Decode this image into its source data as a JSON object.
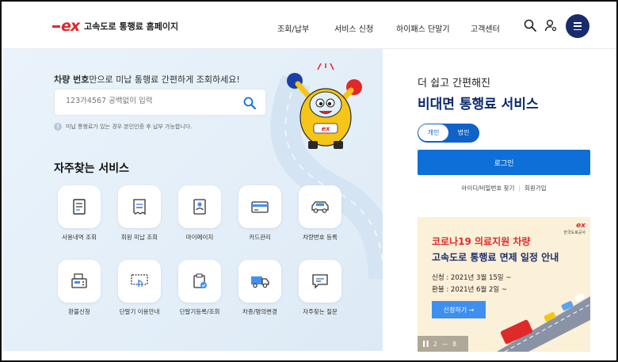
{
  "header": {
    "logo_mark": "ex",
    "site_name": "고속도로 통행료 홈페이지",
    "nav": [
      {
        "label": "조회/납부"
      },
      {
        "label": "서비스 신청"
      },
      {
        "label": "하이패스 단말기"
      },
      {
        "label": "고객센터"
      }
    ]
  },
  "search_section": {
    "headline_bold": "차량 번호",
    "headline_rest": "만으로 미납 통행료 간편하게 조회하세요!",
    "placeholder": "123가4567 공백없이 입력",
    "notice": "미납 통행료가 있는 경우 본인인증 후 납부 가능합니다."
  },
  "frequent": {
    "title": "자주찾는 서비스",
    "items": [
      {
        "label": "사용내역 조회",
        "icon": "document-list-icon"
      },
      {
        "label": "회원 미납 조회",
        "icon": "receipt-icon"
      },
      {
        "label": "마이페이지",
        "icon": "profile-card-icon"
      },
      {
        "label": "카드관리",
        "icon": "credit-card-icon"
      },
      {
        "label": "차량번호 등록",
        "icon": "car-icon"
      },
      {
        "label": "환불신청",
        "icon": "fax-icon"
      },
      {
        "label": "단말기 이용안내",
        "icon": "touch-terminal-icon"
      },
      {
        "label": "단말기등록/조회",
        "icon": "clipboard-check-icon"
      },
      {
        "label": "차종/명의변경",
        "icon": "truck-icon"
      },
      {
        "label": "자주찾는 질문",
        "icon": "chat-bubble-icon"
      }
    ]
  },
  "login_panel": {
    "subtitle": "더 쉽고 간편해진",
    "title": "비대면 통행료 서비스",
    "toggle": {
      "personal": "개인",
      "corporate": "법인"
    },
    "login_label": "로그인",
    "find_id_pw": "아이디/비밀번호 찾기",
    "separator": "|",
    "signup": "회원가입"
  },
  "banner": {
    "logo_mark": "ex",
    "logo_caption": "한국도로공사",
    "line1": "코로나19 의료지원 차량",
    "line2": "고속도로 통행료 면제 일정 안내",
    "date1": "신청 : 2021년 3월 15일 ~",
    "date2": "환불 : 2021년 6월 2일 ~",
    "apply_label": "신청하기 →",
    "pause_icon": "pause-icon",
    "page_current": "2",
    "page_sep": "—",
    "page_total": "8"
  },
  "colors": {
    "brand_red": "#e2262c",
    "navy": "#0a2a6c",
    "primary_blue": "#0f6fd8",
    "panel_bg": "#e6f0f9",
    "banner_bg": "#fbf0d8"
  }
}
